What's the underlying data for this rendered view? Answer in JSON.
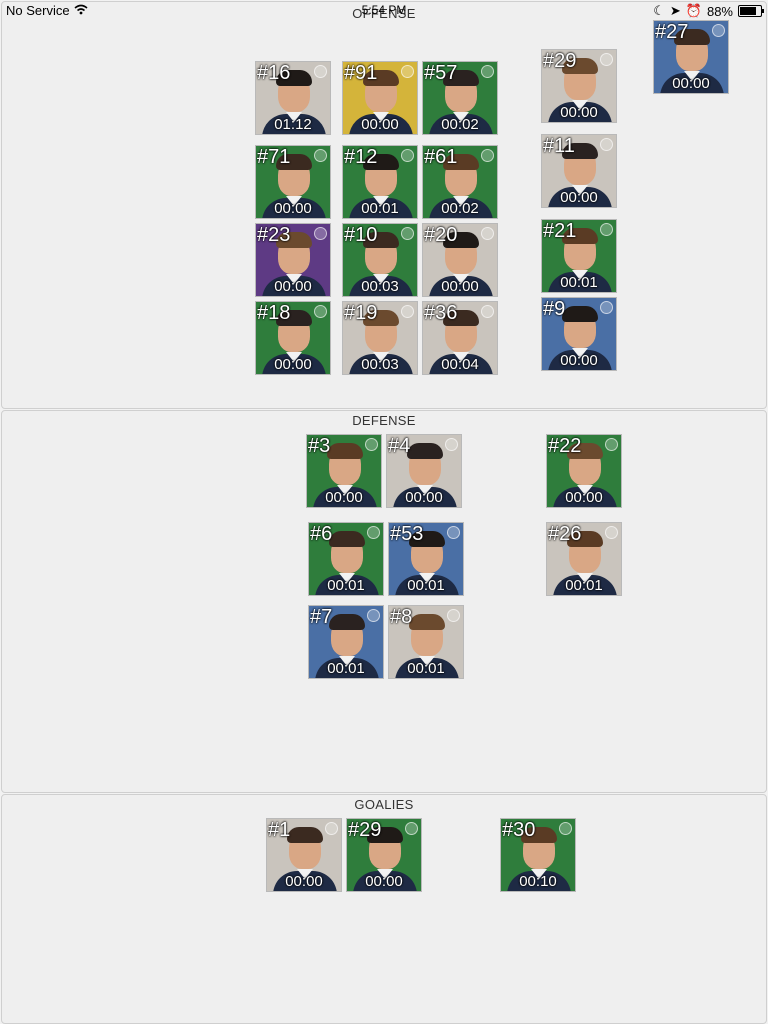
{
  "status": {
    "carrier": "No Service",
    "time": "5:54 PM",
    "battery": "88%",
    "battery_level": 0.88
  },
  "sections": {
    "offense": {
      "title": "OFFENSE"
    },
    "defense": {
      "title": "DEFENSE"
    },
    "goalies": {
      "title": "GOALIES"
    }
  },
  "colors": {
    "green": "#2f7d3c",
    "gold": "#d4b43a",
    "purple": "#5e3a84",
    "blue": "#4a6fa5",
    "grey": "#c9c4bd",
    "white": "#e8e6e2",
    "red": "#c8343a"
  },
  "players": {
    "p27": {
      "number": "#27",
      "time": "00:00",
      "bg": "blue"
    },
    "p16": {
      "number": "#16",
      "time": "01:12",
      "bg": "grey"
    },
    "p91": {
      "number": "#91",
      "time": "00:00",
      "bg": "gold"
    },
    "p57": {
      "number": "#57",
      "time": "00:02",
      "bg": "green"
    },
    "p29o": {
      "number": "#29",
      "time": "00:00",
      "bg": "grey"
    },
    "p71": {
      "number": "#71",
      "time": "00:00",
      "bg": "green"
    },
    "p12": {
      "number": "#12",
      "time": "00:01",
      "bg": "green"
    },
    "p61": {
      "number": "#61",
      "time": "00:02",
      "bg": "green"
    },
    "p11": {
      "number": "#11",
      "time": "00:00",
      "bg": "grey"
    },
    "p23": {
      "number": "#23",
      "time": "00:00",
      "bg": "purple"
    },
    "p10": {
      "number": "#10",
      "time": "00:03",
      "bg": "green"
    },
    "p20": {
      "number": "#20",
      "time": "00:00",
      "bg": "grey"
    },
    "p21": {
      "number": "#21",
      "time": "00:01",
      "bg": "green"
    },
    "p18": {
      "number": "#18",
      "time": "00:00",
      "bg": "green"
    },
    "p19": {
      "number": "#19",
      "time": "00:03",
      "bg": "grey"
    },
    "p36": {
      "number": "#36",
      "time": "00:04",
      "bg": "grey"
    },
    "p9": {
      "number": "#9",
      "time": "00:00",
      "bg": "blue"
    },
    "p3": {
      "number": "#3",
      "time": "00:00",
      "bg": "green"
    },
    "p4": {
      "number": "#4",
      "time": "00:00",
      "bg": "grey"
    },
    "p22": {
      "number": "#22",
      "time": "00:00",
      "bg": "green"
    },
    "p6": {
      "number": "#6",
      "time": "00:01",
      "bg": "green"
    },
    "p53": {
      "number": "#53",
      "time": "00:01",
      "bg": "blue"
    },
    "p26": {
      "number": "#26",
      "time": "00:01",
      "bg": "grey"
    },
    "p7": {
      "number": "#7",
      "time": "00:01",
      "bg": "blue"
    },
    "p8": {
      "number": "#8",
      "time": "00:01",
      "bg": "grey"
    },
    "p1": {
      "number": "#1",
      "time": "00:00",
      "bg": "grey"
    },
    "p29g": {
      "number": "#29",
      "time": "00:00",
      "bg": "green"
    },
    "p30": {
      "number": "#30",
      "time": "00:10",
      "bg": "green"
    }
  }
}
